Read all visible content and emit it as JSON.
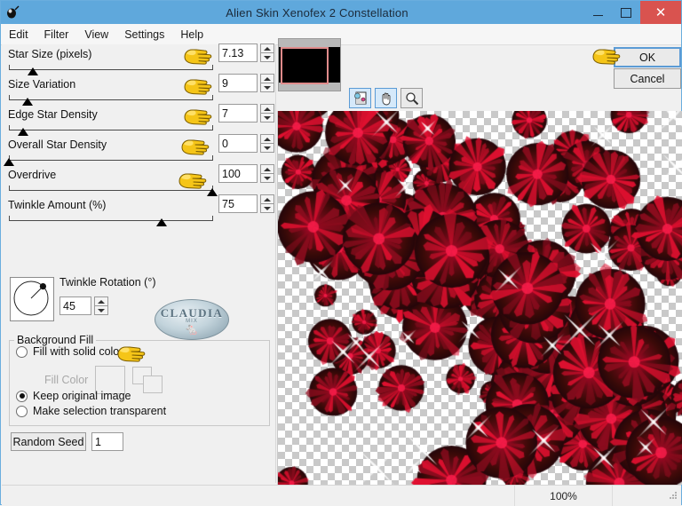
{
  "window": {
    "title": "Alien Skin Xenofex 2 Constellation",
    "app_icon": "mouse-icon",
    "buttons": {
      "minimize": "–",
      "maximize": "□",
      "close": "✕"
    }
  },
  "menu": [
    {
      "label": "Edit"
    },
    {
      "label": "Filter"
    },
    {
      "label": "View"
    },
    {
      "label": "Settings"
    },
    {
      "label": "Help"
    }
  ],
  "sliders": [
    {
      "label": "Star Size (pixels)",
      "value": "7.13",
      "percent": 12
    },
    {
      "label": "Size Variation",
      "value": "9",
      "percent": 9
    },
    {
      "label": "Edge Star Density",
      "value": "7",
      "percent": 7
    },
    {
      "label": "Overall Star Density",
      "value": "0",
      "percent": 0
    },
    {
      "label": "Overdrive",
      "value": "100",
      "percent": 100
    },
    {
      "label": "Twinkle Amount (%)",
      "value": "75",
      "percent": 75
    }
  ],
  "rotation": {
    "label": "Twinkle Rotation (°)",
    "value": "45",
    "dial_angle_deg": 45
  },
  "watermark": {
    "text": "CLAUDIA",
    "subtext": "MIX",
    "glyph": "🐁"
  },
  "background_fill": {
    "group_title": "Background Fill",
    "options": [
      {
        "label": "Fill with solid color",
        "selected": false
      },
      {
        "label": "Keep original image",
        "selected": true
      },
      {
        "label": "Make selection transparent",
        "selected": false
      }
    ],
    "fill_color_label": "Fill Color",
    "fill_color_disabled": true
  },
  "random_seed": {
    "button_label": "Random Seed",
    "value": "1"
  },
  "toolbar": [
    {
      "name": "preview-toggle",
      "selected": true
    },
    {
      "name": "pan-hand",
      "selected": true
    },
    {
      "name": "zoom-magnifier",
      "selected": false
    }
  ],
  "actions": {
    "ok_label": "OK",
    "cancel_label": "Cancel"
  },
  "statusbar": {
    "left_text": "",
    "zoom": "100%"
  },
  "cursors": [
    {
      "name": "pointing-hand-star-size"
    },
    {
      "name": "pointing-hand-size-variation"
    },
    {
      "name": "pointing-hand-edge-star-density"
    },
    {
      "name": "pointing-hand-overall-star-density"
    },
    {
      "name": "pointing-hand-overdrive"
    },
    {
      "name": "pointing-hand-keep-original"
    },
    {
      "name": "pointing-hand-ok"
    }
  ],
  "colors": {
    "titlebar": "#5fa8dc",
    "close_button": "#d9534f",
    "accent_focus": "#5b9bd5",
    "panel_bg": "#f0f0f0",
    "star_red": "#e01030",
    "star_dark": "#3a0a08",
    "selection_rect": "#e08b8b"
  },
  "preview": {
    "description": "transparency checkerboard with dark red starburst flower clusters",
    "checker_size_px": 16
  }
}
